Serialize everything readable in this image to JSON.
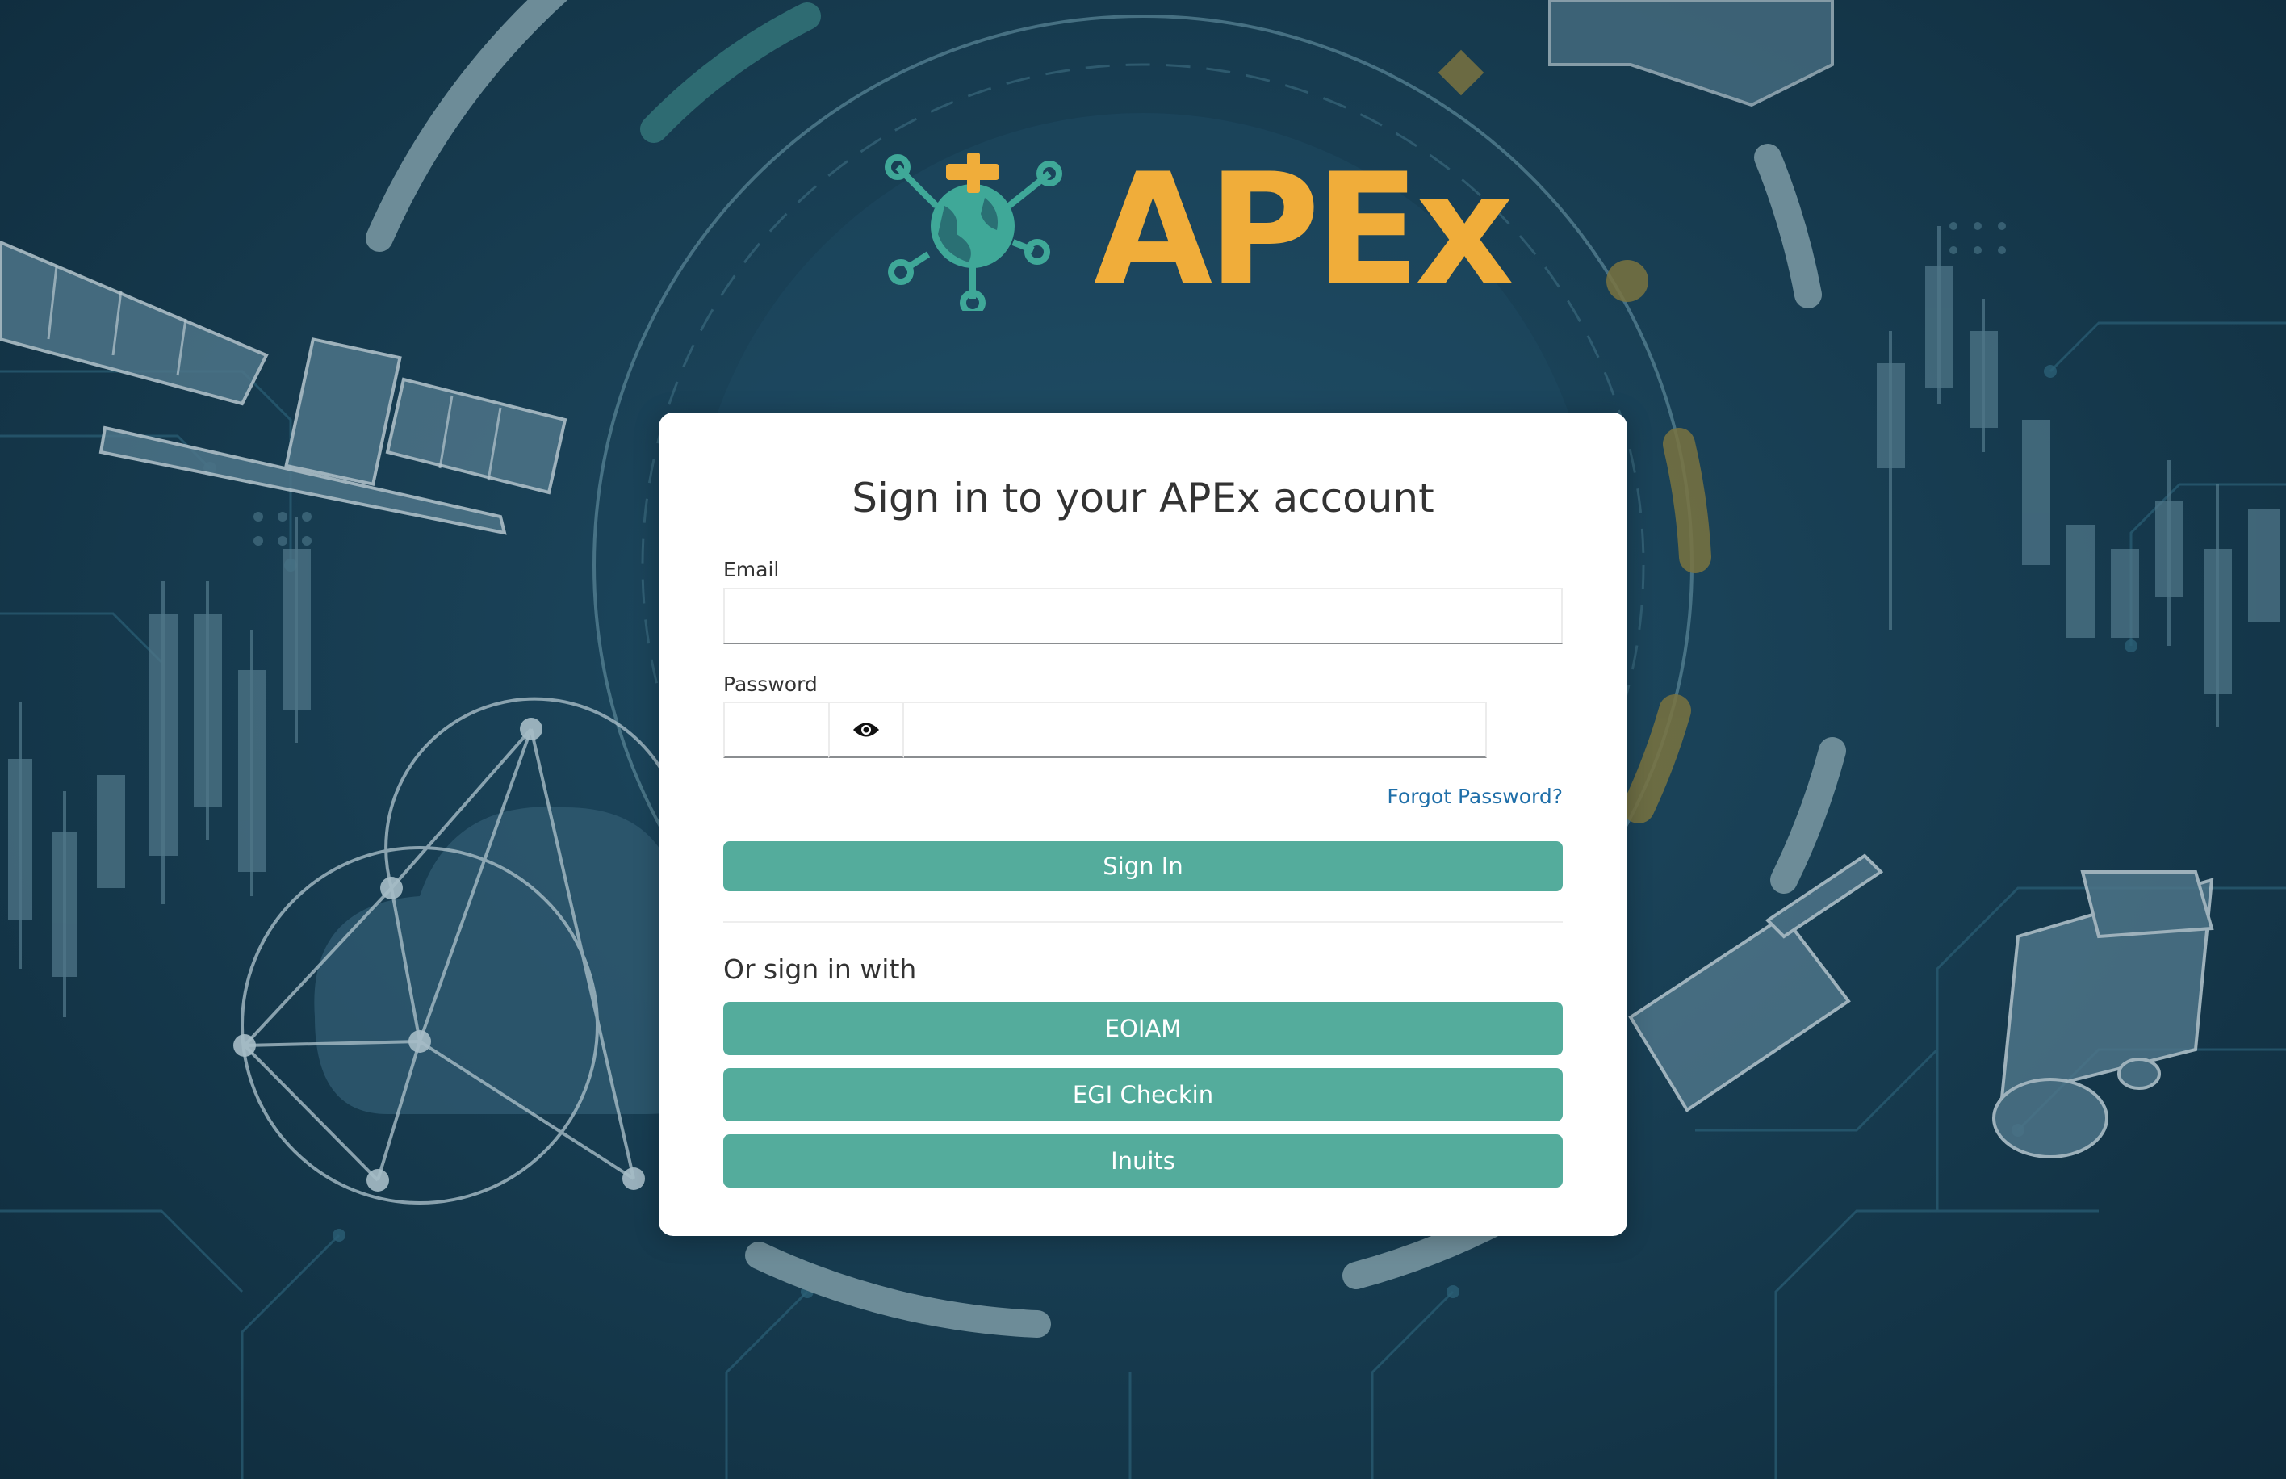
{
  "brand": {
    "name": "APEx",
    "colors": {
      "brand_orange": "#f0ad3a",
      "brand_teal": "#3fa898",
      "button_teal": "#54ac9c",
      "link_blue": "#1f6fa9",
      "background_navy": "#1a4258"
    }
  },
  "login": {
    "title": "Sign in to your APEx account",
    "email_label": "Email",
    "email_value": "",
    "password_label": "Password",
    "password_value": "",
    "show_password_icon": "eye-icon",
    "forgot_password": "Forgot Password?",
    "sign_in_button": "Sign In",
    "or_sign_in_with": "Or sign in with",
    "providers": [
      "EOIAM",
      "EGI Checkin",
      "Inuits"
    ]
  }
}
